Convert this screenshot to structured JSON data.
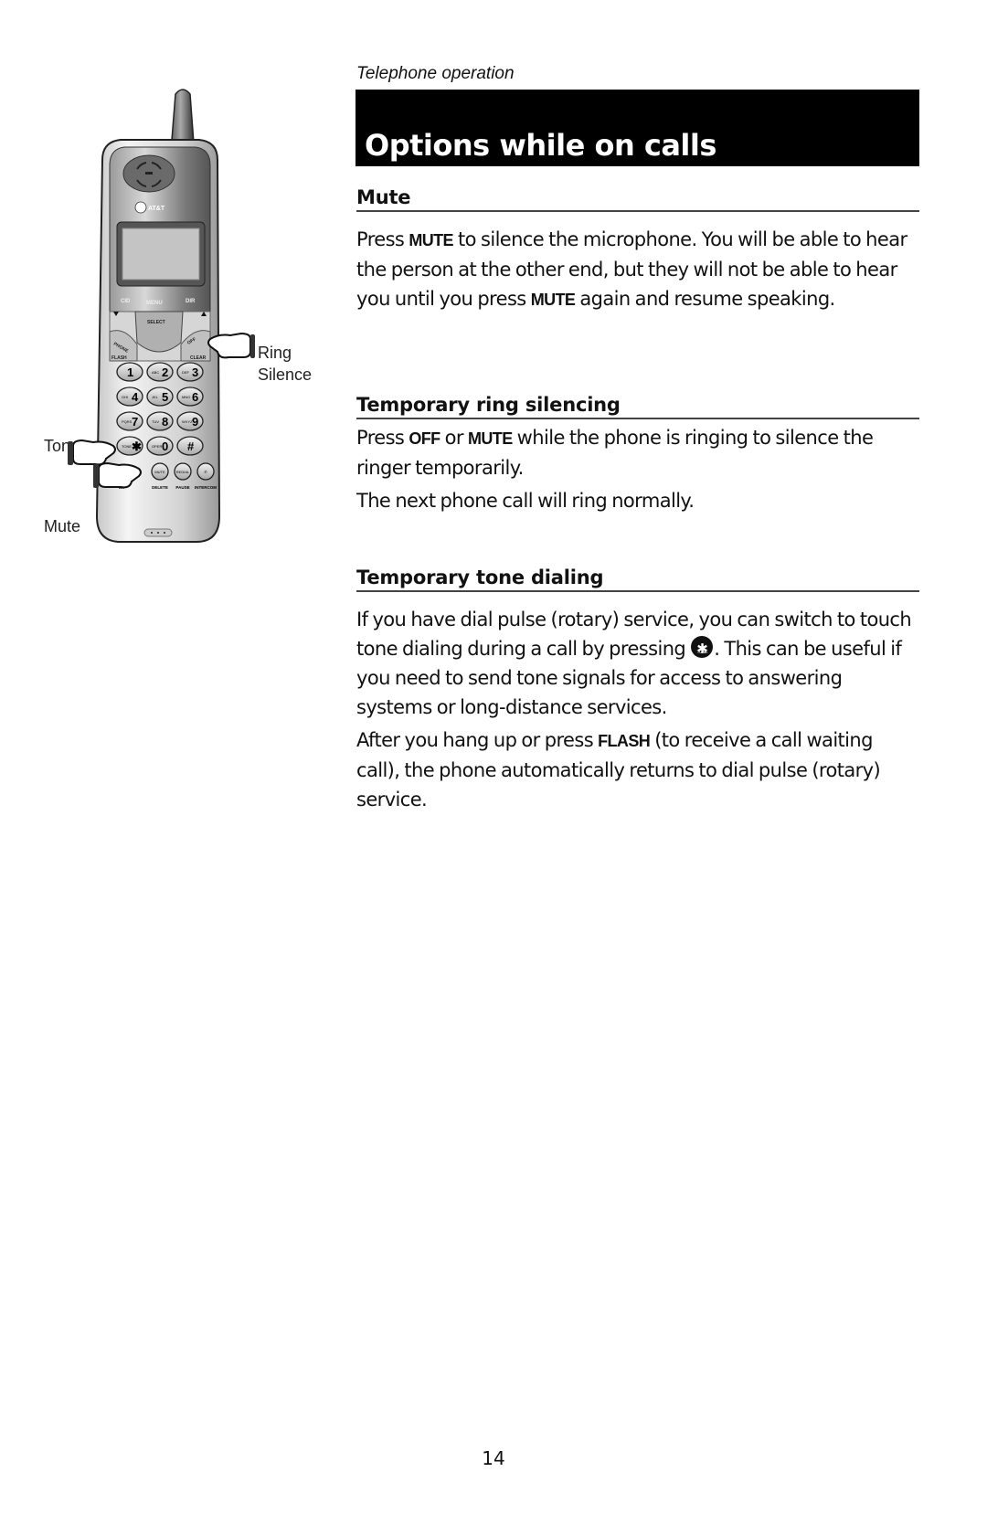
{
  "header": {
    "section_label": "Telephone operation",
    "title": "Options while on calls"
  },
  "sections": [
    {
      "heading": "Mute",
      "paragraphs": [
        {
          "parts": [
            "Press ",
            "MUTE",
            " to silence the microphone. You will be able to hear the person at the other end, but they will not be able to hear you until you press ",
            "MUTE",
            " again and resume speaking."
          ]
        }
      ]
    },
    {
      "heading": "Temporary ring silencing",
      "paragraphs": [
        {
          "parts": [
            "Press ",
            "OFF",
            " or ",
            "MUTE",
            " while the phone is ringing to silence the ringer temporarily."
          ]
        },
        {
          "text": "The next phone call will ring normally."
        }
      ]
    },
    {
      "heading": "Temporary tone dialing",
      "paragraphs": [
        {
          "before": "If you have dial pulse (rotary) service, you can switch to touch tone dialing during a call by pressing ",
          "after": ". This can be useful if you need to send tone signals for access to answering systems or long-distance services."
        },
        {
          "parts": [
            "After you hang up or press ",
            "FLASH",
            " (to receive a call waiting call), the phone automatically returns to dial pulse (rotary) service."
          ]
        }
      ]
    }
  ],
  "inline_key": {
    "icon": "tone-star-key-icon",
    "label": "TONE",
    "glyph": "✱"
  },
  "illustration": {
    "callouts": {
      "ring_silence": [
        "Ring",
        "Silence"
      ],
      "tone": "Tone",
      "mute": "Mute"
    },
    "brand": "AT&T",
    "soft_keys": {
      "left": "CID",
      "center": "MENU",
      "right": "DIR"
    },
    "nav": {
      "select": "SELECT",
      "phone": "PHONE",
      "off": "OFF",
      "flash": "FLASH",
      "clear": "CLEAR"
    },
    "keypad": [
      {
        "sub": "",
        "main": "1"
      },
      {
        "sub": "ABC",
        "main": "2"
      },
      {
        "sub": "DEF",
        "main": "3"
      },
      {
        "sub": "GHI",
        "main": "4"
      },
      {
        "sub": "JKL",
        "main": "5"
      },
      {
        "sub": "MNO",
        "main": "6"
      },
      {
        "sub": "PQRS",
        "main": "7"
      },
      {
        "sub": "TUV",
        "main": "8"
      },
      {
        "sub": "WXYZ",
        "main": "9"
      },
      {
        "sub": "TONE",
        "main": "✱"
      },
      {
        "sub": "OPER",
        "main": "0"
      },
      {
        "sub": "",
        "main": "#"
      }
    ],
    "bottom_keys": [
      {
        "label": "MUTE",
        "under": "DELETE"
      },
      {
        "label": "REDIAL",
        "under": "PAUSE"
      },
      {
        "label": "",
        "under": "INTERCOM"
      }
    ],
    "bottom_left_partial": "ER"
  },
  "footer": {
    "page_number": "14"
  }
}
